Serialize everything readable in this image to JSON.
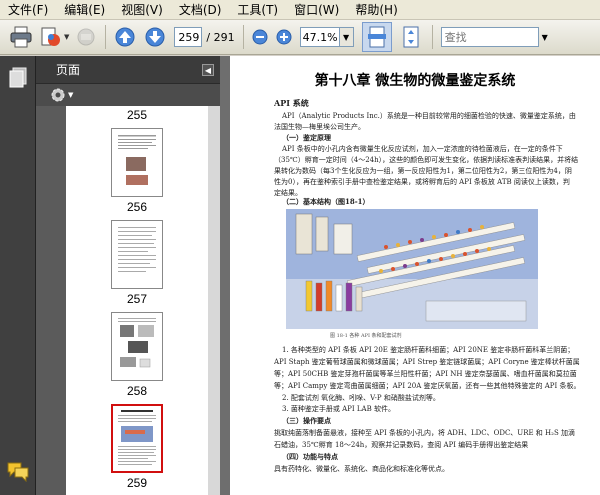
{
  "menu": [
    "文件(F)",
    "编辑(E)",
    "视图(V)",
    "文档(D)",
    "工具(T)",
    "窗口(W)",
    "帮助(H)"
  ],
  "toolbar": {
    "page_current": "259",
    "page_total": "/ 291",
    "zoom": "47.1%",
    "search_placeholder": "查找"
  },
  "panel": {
    "title": "页面",
    "thumbnails": [
      {
        "label": "255"
      },
      {
        "label": "256"
      },
      {
        "label": "257"
      },
      {
        "label": "258"
      },
      {
        "label": "259"
      }
    ]
  },
  "document": {
    "title": "第十八章  微生物的微量鉴定系统",
    "section": "API 系统",
    "intro_1": "API（Analytic Products Inc.）系统是一种目前较常用的细菌检验的快速、微量鉴定系统，由",
    "intro_2": "法国生物—梅里埃公司生产。",
    "h1": "（一）鉴定原理",
    "p1_1": "API 条板中的小孔内含有微量生化反应试剂，加入一定浓度的待检菌液后，在一定的条件下",
    "p1_2": "（35℃）孵育一定时间（4～24h），这些的颜色即可发生变化，依据判读标准表判读结果，并将结",
    "p1_3": "果转化为数码（每3个生化反应为一组，第一反应阳性为1，第二位阳性为2，第三位阳性为4，阴",
    "p1_4": "性为0），再在鉴种索引手册中查检鉴定结果，或将孵育后的 API 条板放 ATB 阅读仪上读数，判",
    "p1_5": "定结果。",
    "h2": "（二）基本结构（图18-1）",
    "caption": "图 18-1    各种 API 条和配套试剂",
    "p2_1": "1. 各种类型的 API 条板   API 20E 鉴定肠杆菌科细菌；API 20NE 鉴定非肠杆菌科革兰阴菌；",
    "p2_2": "API Staph 鉴定葡萄球菌属和微球菌属；API Strep 鉴定链球菌属；API Coryne 鉴定棒状杆菌属",
    "p2_3": "等；API 50CHB 鉴定芽孢杆菌属等革兰阳性杆菌；API NH 鉴定奈瑟菌属、嗜血杆菌属和莫拉菌",
    "p2_4": "等；API Campy 鉴定弯曲菌属细菌；API 20A 鉴定厌氧菌，还有一些其他特殊鉴定的 API 条板。",
    "p2_5": "2. 配套试剂   氧化酶、吲哚、V-P 和硝酸盐试剂等。",
    "p2_6": "3. 菌种鉴定手册或 API LAB 软件。",
    "h3": "（三）操作要点",
    "p3_1": "挑取纯菌落制备菌悬液，接种至 API 条板的小孔内，将 ADH、LDC、ODC、URE 和 H₂S 加滴",
    "p3_2": "石蜡油，35℃孵育 18～24h，观察并记录数码，查阅 API 编码手册得出鉴定结果",
    "h4": "（四）功能与特点",
    "p4_1": "具有药特化、微量化、系统化、商品化和标准化等优点。"
  }
}
